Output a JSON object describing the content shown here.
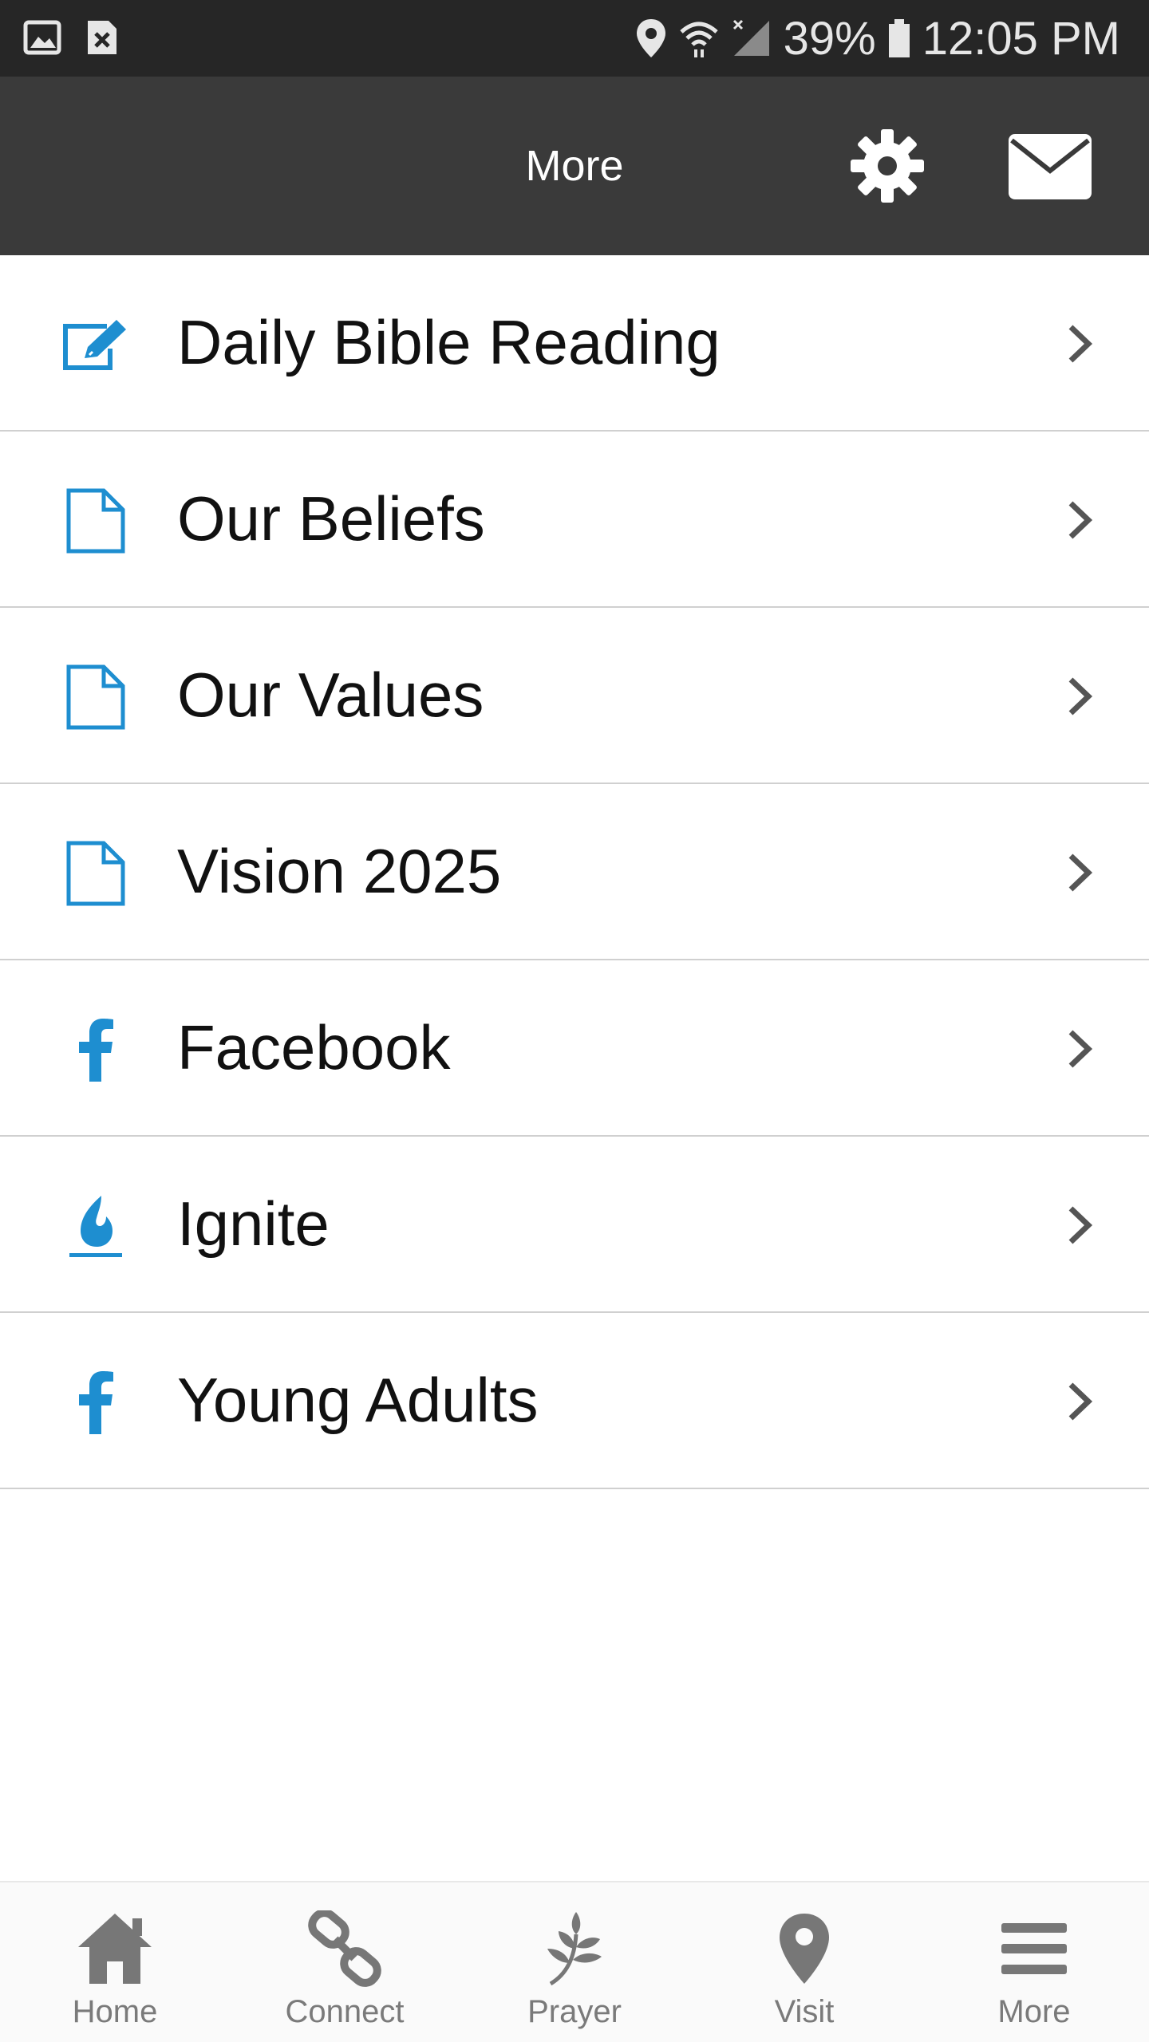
{
  "status_bar": {
    "battery": "39%",
    "time": "12:05 PM",
    "icons": [
      "image-icon",
      "close-notification-icon",
      "location-icon",
      "wifi-icon",
      "signal-icon",
      "battery-icon"
    ]
  },
  "header": {
    "title": "More",
    "icons": [
      "gear-icon",
      "mail-icon"
    ],
    "background": "#3a3a3a"
  },
  "menu": {
    "accent_color": "#1e8ed0",
    "items": [
      {
        "label": "Daily Bible Reading",
        "icon": "edit-icon"
      },
      {
        "label": "Our Beliefs",
        "icon": "document-icon"
      },
      {
        "label": "Our Values",
        "icon": "document-icon"
      },
      {
        "label": "Vision 2025",
        "icon": "document-icon"
      },
      {
        "label": "Facebook",
        "icon": "facebook-icon"
      },
      {
        "label": "Ignite",
        "icon": "flame-icon"
      },
      {
        "label": "Young Adults",
        "icon": "facebook-icon"
      }
    ]
  },
  "tab_bar": {
    "tabs": [
      {
        "label": "Home",
        "icon": "home-icon"
      },
      {
        "label": "Connect",
        "icon": "link-icon"
      },
      {
        "label": "Prayer",
        "icon": "plant-icon"
      },
      {
        "label": "Visit",
        "icon": "map-pin-icon"
      },
      {
        "label": "More",
        "icon": "menu-icon"
      }
    ]
  }
}
